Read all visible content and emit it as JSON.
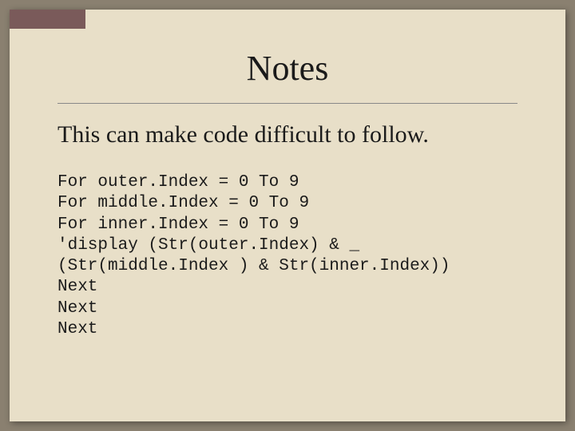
{
  "slide": {
    "title": "Notes",
    "subtitle": "This can make code difficult to follow.",
    "code": {
      "line1": "For outer.Index = 0 To 9",
      "line2": "For middle.Index = 0 To 9",
      "line3": "For inner.Index = 0 To 9",
      "line4": "'display (Str(outer.Index) & _",
      "line5": "(Str(middle.Index ) & Str(inner.Index))",
      "line6": "Next",
      "line7": "Next",
      "line8": "Next"
    }
  }
}
